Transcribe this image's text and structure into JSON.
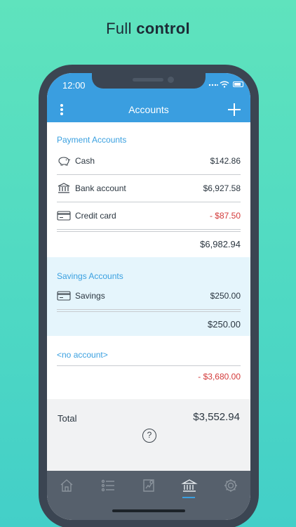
{
  "headline": {
    "normal": "Full ",
    "bold": "control"
  },
  "status": {
    "time": "12:00"
  },
  "navbar": {
    "title": "Accounts"
  },
  "payment": {
    "title": "Payment Accounts",
    "items": [
      {
        "icon": "piggy-bank-icon",
        "name": "Cash",
        "amount": "$142.86",
        "negative": false
      },
      {
        "icon": "bank-icon",
        "name": "Bank account",
        "amount": "$6,927.58",
        "negative": false
      },
      {
        "icon": "credit-card-icon",
        "name": "Credit card",
        "amount": "- $87.50",
        "negative": true
      }
    ],
    "subtotal": "$6,982.94"
  },
  "savings": {
    "title": "Savings Accounts",
    "items": [
      {
        "icon": "credit-card-icon",
        "name": "Savings",
        "amount": "$250.00",
        "negative": false
      }
    ],
    "subtotal": "$250.00"
  },
  "noaccount": {
    "title": "<no account>",
    "amount": "- $3,680.00"
  },
  "total": {
    "label": "Total",
    "value": "$3,552.94",
    "help": "?"
  },
  "tabs": [
    {
      "name": "home",
      "icon": "home-icon",
      "active": false
    },
    {
      "name": "transactions",
      "icon": "list-icon",
      "active": false
    },
    {
      "name": "reports",
      "icon": "report-icon",
      "active": false
    },
    {
      "name": "accounts",
      "icon": "bank-icon",
      "active": true
    },
    {
      "name": "settings",
      "icon": "gear-icon",
      "active": false
    }
  ],
  "colors": {
    "accent": "#3a9ee0",
    "negative": "#d33a3a",
    "background": "#4fd9c3"
  }
}
